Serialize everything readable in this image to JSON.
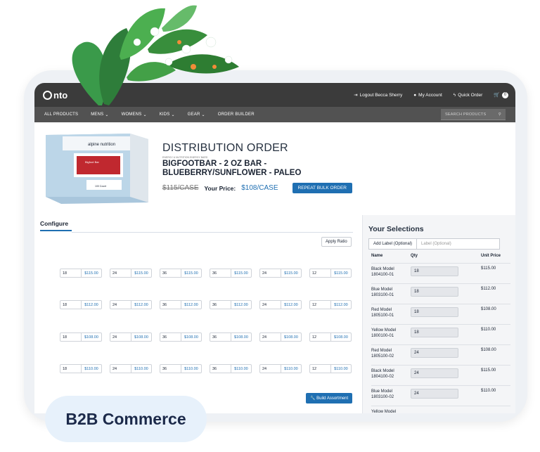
{
  "colors": {
    "accent": "#1f6fb2",
    "topbar": "#3b3b3b",
    "nav": "#525252"
  },
  "header": {
    "logo": "nto",
    "logout": "Logout Becca Sherry",
    "account": "My Account",
    "quick_order": "Quick Order",
    "cart_count": "0"
  },
  "nav": {
    "items": [
      "ALL PRODUCTS",
      "MENS",
      "WOMENS",
      "KIDS",
      "GEAR",
      "ORDER BUILDER"
    ],
    "search_placeholder": "SEARCH PRODUCTS"
  },
  "product": {
    "brand": "alpine nutrition",
    "box_label": "Bigfoot Bar",
    "box_count": "100 Count",
    "title": "DISTRIBUTION ORDER",
    "subtitle": "ENERGY & NUTRITION ENERGY BARS",
    "name": "BIGFOOTBAR - 2 OZ BAR - BLUEBERRY/SUNFLOWER - PALEO",
    "old_price": "$115/CASE",
    "your_price_label": "Your Price:",
    "new_price": "$108/CASE",
    "repeat_button": "REPEAT BULK ORDER"
  },
  "configure": {
    "tab": "Configure",
    "apply_button": "Apply Ratio",
    "rows": [
      [
        [
          "18",
          "$115.00"
        ],
        [
          "24",
          "$115.00"
        ],
        [
          "36",
          "$115.00"
        ],
        [
          "36",
          "$115.00"
        ],
        [
          "24",
          "$115.00"
        ],
        [
          "12",
          "$115.00"
        ]
      ],
      [
        [
          "18",
          "$112.00"
        ],
        [
          "24",
          "$112.00"
        ],
        [
          "36",
          "$112.00"
        ],
        [
          "36",
          "$112.00"
        ],
        [
          "24",
          "$112.00"
        ],
        [
          "12",
          "$112.00"
        ]
      ],
      [
        [
          "18",
          "$108.00"
        ],
        [
          "24",
          "$108.00"
        ],
        [
          "36",
          "$108.00"
        ],
        [
          "36",
          "$108.00"
        ],
        [
          "24",
          "$108.00"
        ],
        [
          "12",
          "$108.00"
        ]
      ],
      [
        [
          "18",
          "$110.00"
        ],
        [
          "24",
          "$110.00"
        ],
        [
          "36",
          "$110.00"
        ],
        [
          "36",
          "$110.00"
        ],
        [
          "24",
          "$110.00"
        ],
        [
          "12",
          "$110.00"
        ]
      ]
    ],
    "build_button": "Build Assortment"
  },
  "selections": {
    "title": "Your Selections",
    "add_label_button": "Add Label (Optional)",
    "label_placeholder": "Label (Optional)",
    "headers": {
      "name": "Name",
      "qty": "Qty",
      "price": "Unit Price"
    },
    "rows": [
      {
        "name1": "Black Model",
        "name2": "1804100-01",
        "qty": "18",
        "price": "$115.00"
      },
      {
        "name1": "Blue Model",
        "name2": "1803100-01",
        "qty": "18",
        "price": "$112.00"
      },
      {
        "name1": "Red Model",
        "name2": "1805100-01",
        "qty": "18",
        "price": "$108.00"
      },
      {
        "name1": "Yellow Model",
        "name2": "1800100-01",
        "qty": "18",
        "price": "$110.00"
      },
      {
        "name1": "Red Model",
        "name2": "1805100-02",
        "qty": "24",
        "price": "$108.00"
      },
      {
        "name1": "Black Model",
        "name2": "1804100-02",
        "qty": "24",
        "price": "$115.00"
      },
      {
        "name1": "Blue Model",
        "name2": "1803100-02",
        "qty": "24",
        "price": "$110.00"
      },
      {
        "name1": "Yellow Model",
        "name2": "",
        "qty": "",
        "price": ""
      }
    ]
  },
  "badge": "B2B Commerce"
}
